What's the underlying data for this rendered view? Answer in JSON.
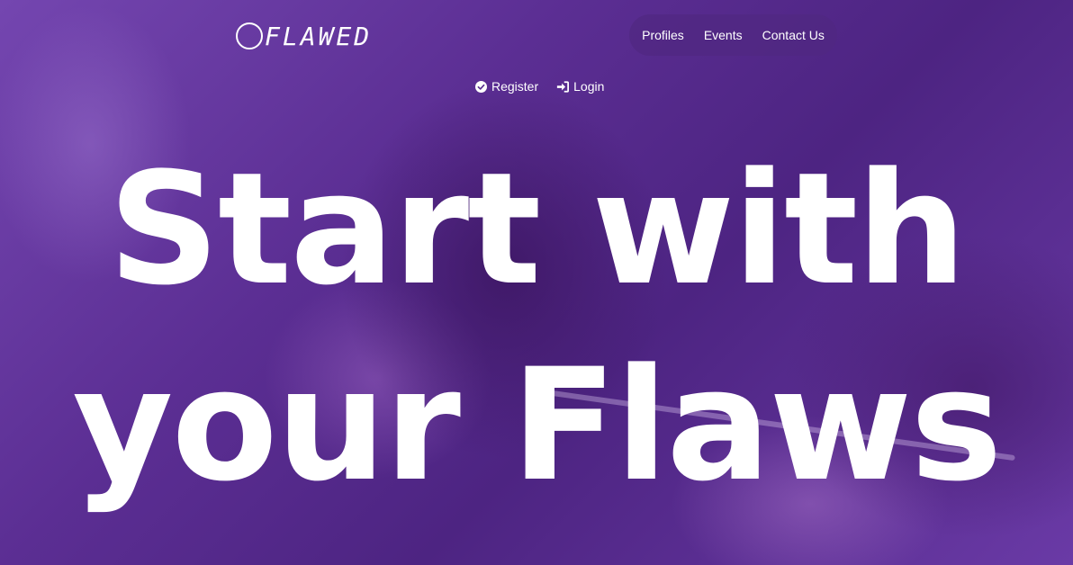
{
  "brand": {
    "name": "FLAWED",
    "logo_icon": "circle-logo-icon"
  },
  "nav": {
    "items": [
      {
        "label": "Profiles"
      },
      {
        "label": "Events"
      },
      {
        "label": "Contact Us"
      }
    ]
  },
  "auth": {
    "register": {
      "label": "Register",
      "icon": "check-circle-icon"
    },
    "login": {
      "label": "Login",
      "icon": "sign-in-icon"
    }
  },
  "hero": {
    "headline_line1": "Start with",
    "headline_line2": "your Flaws"
  },
  "colors": {
    "overlay": "#5a2f8e",
    "text": "#ffffff",
    "nav_pill": "#50288a"
  }
}
